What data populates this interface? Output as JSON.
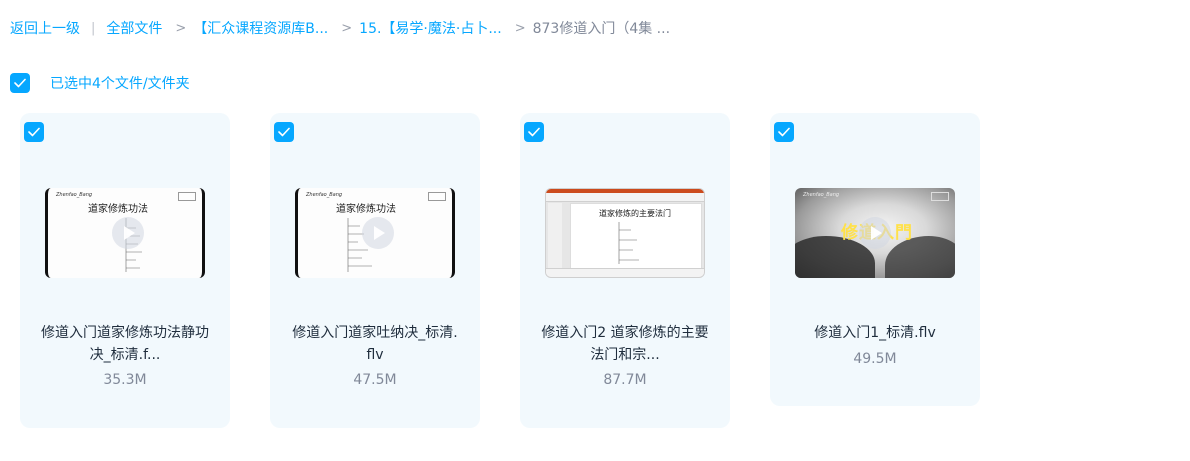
{
  "breadcrumb": {
    "back": "返回上一级",
    "sep": "|",
    "items": [
      "全部文件",
      "【汇众课程资源库B...",
      "15.【易学·魔法·占卜...",
      "873修道入门（4集 ..."
    ],
    "arrow": ">"
  },
  "selection": {
    "text": "已选中4个文件/文件夹"
  },
  "files": [
    {
      "name_line1": "修道入门道家修炼功法静功",
      "name_line2": "决_标清.f...",
      "size": "35.3M"
    },
    {
      "name_line1": "修道入门道家吐纳决_标清.",
      "name_line2": "flv",
      "size": "47.5M"
    },
    {
      "name_line1": "修道入门2 道家修炼的主要",
      "name_line2": "法门和宗...",
      "size": "87.7M"
    },
    {
      "name_line1": "修道入门1_标清.flv",
      "name_line2": "",
      "size": "49.5M"
    }
  ],
  "colors": {
    "accent": "#06a7ff",
    "card_bg": "#f2f9fd",
    "muted": "#818999"
  },
  "icons": {
    "check": "checkmark-icon",
    "play": "play-icon"
  }
}
